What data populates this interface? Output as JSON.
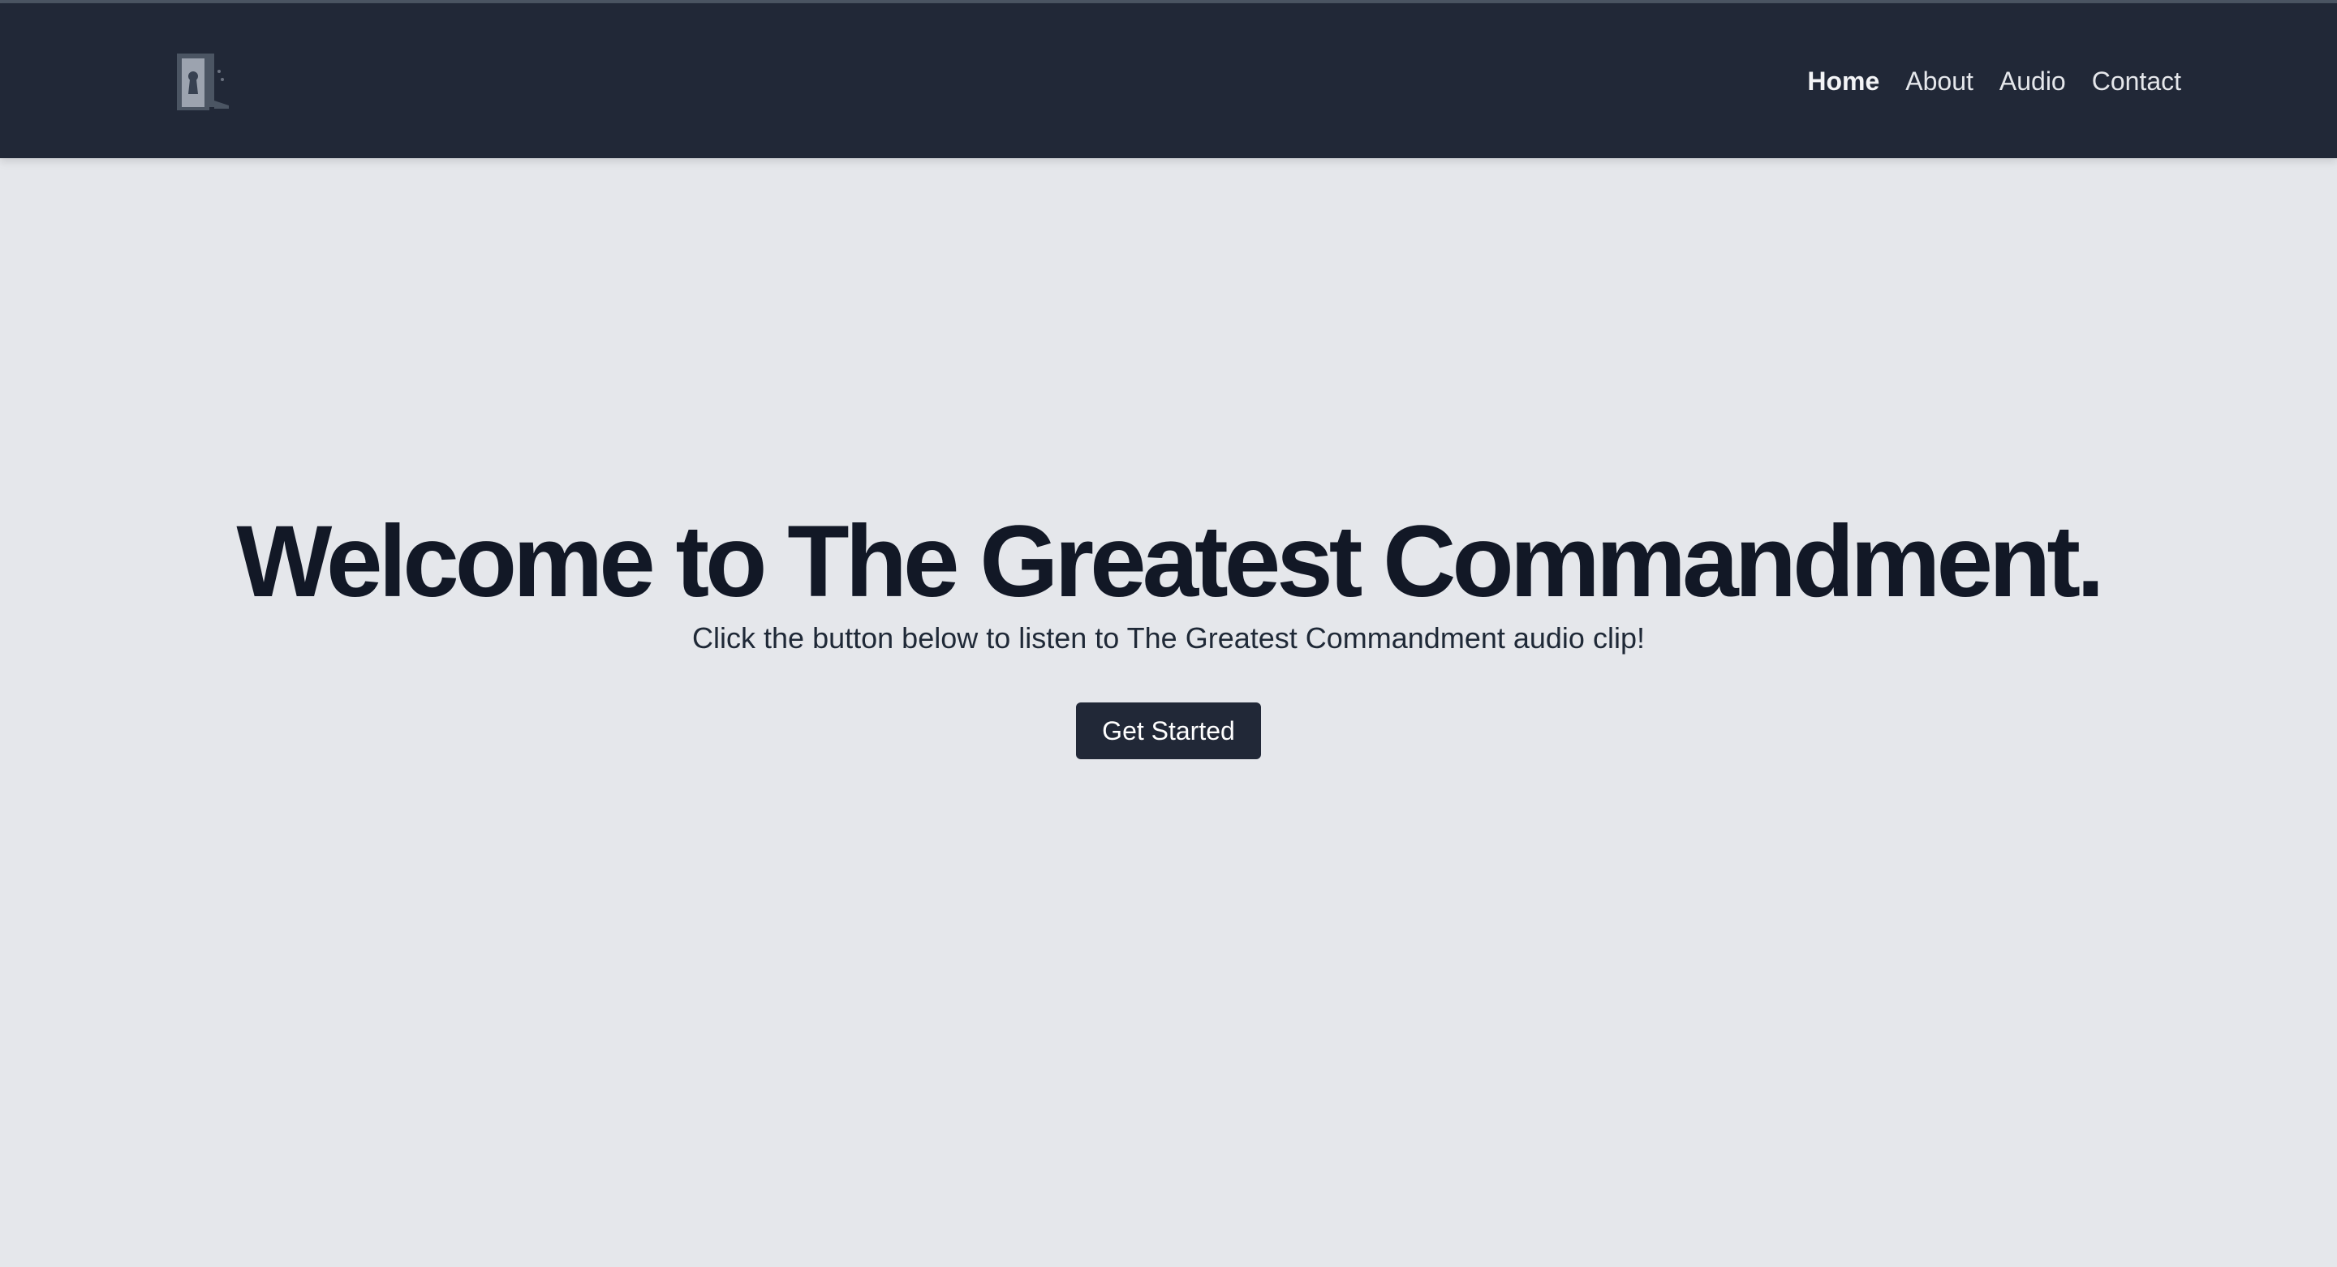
{
  "navbar": {
    "logo_icon": "door-logo-icon",
    "links": [
      {
        "label": "Home",
        "active": true
      },
      {
        "label": "About",
        "active": false
      },
      {
        "label": "Audio",
        "active": false
      },
      {
        "label": "Contact",
        "active": false
      }
    ]
  },
  "hero": {
    "title": "Welcome to The Greatest Commandment.",
    "subtitle": "Click the button below to listen to The Greatest Commandment audio clip!",
    "button_label": "Get Started"
  },
  "colors": {
    "navbar_bg": "#212837",
    "page_bg": "#e5e7eb",
    "title_text": "#121826",
    "button_bg": "#212837"
  }
}
